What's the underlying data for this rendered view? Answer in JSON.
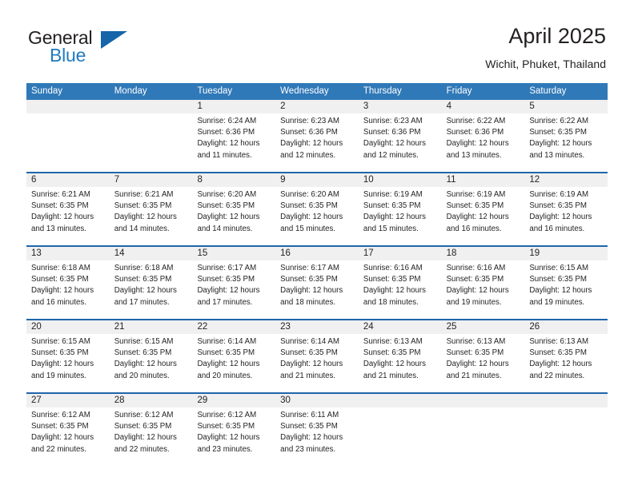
{
  "brand": {
    "general": "General",
    "blue": "Blue",
    "flag_icon": "triangle-flag-icon",
    "accent_color": "#1565a8",
    "blue_text_color": "#1f7ac1"
  },
  "header": {
    "title": "April 2025",
    "subtitle": "Wichit, Phuket, Thailand"
  },
  "colors": {
    "header_bar": "#3079b8",
    "week_separator": "#1f66ab",
    "daynum_band": "#f0f0f0",
    "text": "#231f20"
  },
  "weekdays": [
    "Sunday",
    "Monday",
    "Tuesday",
    "Wednesday",
    "Thursday",
    "Friday",
    "Saturday"
  ],
  "weeks": [
    {
      "days": [
        {
          "num": "",
          "lines": []
        },
        {
          "num": "",
          "lines": []
        },
        {
          "num": "1",
          "lines": [
            "Sunrise: 6:24 AM",
            "Sunset: 6:36 PM",
            "Daylight: 12 hours",
            "and 11 minutes."
          ]
        },
        {
          "num": "2",
          "lines": [
            "Sunrise: 6:23 AM",
            "Sunset: 6:36 PM",
            "Daylight: 12 hours",
            "and 12 minutes."
          ]
        },
        {
          "num": "3",
          "lines": [
            "Sunrise: 6:23 AM",
            "Sunset: 6:36 PM",
            "Daylight: 12 hours",
            "and 12 minutes."
          ]
        },
        {
          "num": "4",
          "lines": [
            "Sunrise: 6:22 AM",
            "Sunset: 6:36 PM",
            "Daylight: 12 hours",
            "and 13 minutes."
          ]
        },
        {
          "num": "5",
          "lines": [
            "Sunrise: 6:22 AM",
            "Sunset: 6:35 PM",
            "Daylight: 12 hours",
            "and 13 minutes."
          ]
        }
      ]
    },
    {
      "days": [
        {
          "num": "6",
          "lines": [
            "Sunrise: 6:21 AM",
            "Sunset: 6:35 PM",
            "Daylight: 12 hours",
            "and 13 minutes."
          ]
        },
        {
          "num": "7",
          "lines": [
            "Sunrise: 6:21 AM",
            "Sunset: 6:35 PM",
            "Daylight: 12 hours",
            "and 14 minutes."
          ]
        },
        {
          "num": "8",
          "lines": [
            "Sunrise: 6:20 AM",
            "Sunset: 6:35 PM",
            "Daylight: 12 hours",
            "and 14 minutes."
          ]
        },
        {
          "num": "9",
          "lines": [
            "Sunrise: 6:20 AM",
            "Sunset: 6:35 PM",
            "Daylight: 12 hours",
            "and 15 minutes."
          ]
        },
        {
          "num": "10",
          "lines": [
            "Sunrise: 6:19 AM",
            "Sunset: 6:35 PM",
            "Daylight: 12 hours",
            "and 15 minutes."
          ]
        },
        {
          "num": "11",
          "lines": [
            "Sunrise: 6:19 AM",
            "Sunset: 6:35 PM",
            "Daylight: 12 hours",
            "and 16 minutes."
          ]
        },
        {
          "num": "12",
          "lines": [
            "Sunrise: 6:19 AM",
            "Sunset: 6:35 PM",
            "Daylight: 12 hours",
            "and 16 minutes."
          ]
        }
      ]
    },
    {
      "days": [
        {
          "num": "13",
          "lines": [
            "Sunrise: 6:18 AM",
            "Sunset: 6:35 PM",
            "Daylight: 12 hours",
            "and 16 minutes."
          ]
        },
        {
          "num": "14",
          "lines": [
            "Sunrise: 6:18 AM",
            "Sunset: 6:35 PM",
            "Daylight: 12 hours",
            "and 17 minutes."
          ]
        },
        {
          "num": "15",
          "lines": [
            "Sunrise: 6:17 AM",
            "Sunset: 6:35 PM",
            "Daylight: 12 hours",
            "and 17 minutes."
          ]
        },
        {
          "num": "16",
          "lines": [
            "Sunrise: 6:17 AM",
            "Sunset: 6:35 PM",
            "Daylight: 12 hours",
            "and 18 minutes."
          ]
        },
        {
          "num": "17",
          "lines": [
            "Sunrise: 6:16 AM",
            "Sunset: 6:35 PM",
            "Daylight: 12 hours",
            "and 18 minutes."
          ]
        },
        {
          "num": "18",
          "lines": [
            "Sunrise: 6:16 AM",
            "Sunset: 6:35 PM",
            "Daylight: 12 hours",
            "and 19 minutes."
          ]
        },
        {
          "num": "19",
          "lines": [
            "Sunrise: 6:15 AM",
            "Sunset: 6:35 PM",
            "Daylight: 12 hours",
            "and 19 minutes."
          ]
        }
      ]
    },
    {
      "days": [
        {
          "num": "20",
          "lines": [
            "Sunrise: 6:15 AM",
            "Sunset: 6:35 PM",
            "Daylight: 12 hours",
            "and 19 minutes."
          ]
        },
        {
          "num": "21",
          "lines": [
            "Sunrise: 6:15 AM",
            "Sunset: 6:35 PM",
            "Daylight: 12 hours",
            "and 20 minutes."
          ]
        },
        {
          "num": "22",
          "lines": [
            "Sunrise: 6:14 AM",
            "Sunset: 6:35 PM",
            "Daylight: 12 hours",
            "and 20 minutes."
          ]
        },
        {
          "num": "23",
          "lines": [
            "Sunrise: 6:14 AM",
            "Sunset: 6:35 PM",
            "Daylight: 12 hours",
            "and 21 minutes."
          ]
        },
        {
          "num": "24",
          "lines": [
            "Sunrise: 6:13 AM",
            "Sunset: 6:35 PM",
            "Daylight: 12 hours",
            "and 21 minutes."
          ]
        },
        {
          "num": "25",
          "lines": [
            "Sunrise: 6:13 AM",
            "Sunset: 6:35 PM",
            "Daylight: 12 hours",
            "and 21 minutes."
          ]
        },
        {
          "num": "26",
          "lines": [
            "Sunrise: 6:13 AM",
            "Sunset: 6:35 PM",
            "Daylight: 12 hours",
            "and 22 minutes."
          ]
        }
      ]
    },
    {
      "days": [
        {
          "num": "27",
          "lines": [
            "Sunrise: 6:12 AM",
            "Sunset: 6:35 PM",
            "Daylight: 12 hours",
            "and 22 minutes."
          ]
        },
        {
          "num": "28",
          "lines": [
            "Sunrise: 6:12 AM",
            "Sunset: 6:35 PM",
            "Daylight: 12 hours",
            "and 22 minutes."
          ]
        },
        {
          "num": "29",
          "lines": [
            "Sunrise: 6:12 AM",
            "Sunset: 6:35 PM",
            "Daylight: 12 hours",
            "and 23 minutes."
          ]
        },
        {
          "num": "30",
          "lines": [
            "Sunrise: 6:11 AM",
            "Sunset: 6:35 PM",
            "Daylight: 12 hours",
            "and 23 minutes."
          ]
        },
        {
          "num": "",
          "lines": []
        },
        {
          "num": "",
          "lines": []
        },
        {
          "num": "",
          "lines": []
        }
      ]
    }
  ]
}
